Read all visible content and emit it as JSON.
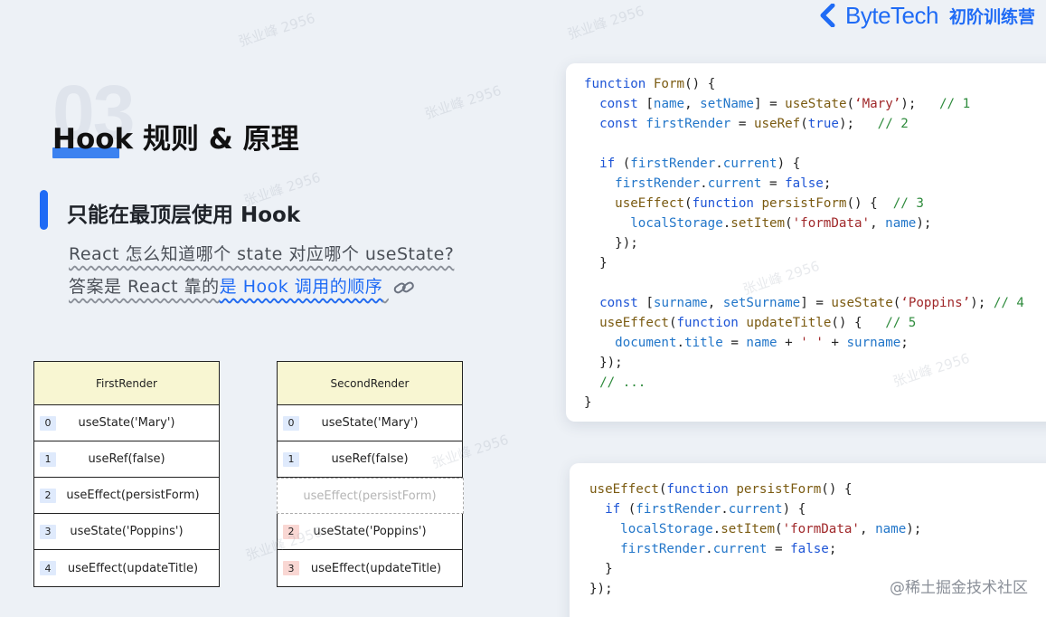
{
  "brand": {
    "name": "ByteTech",
    "subtitle": "初阶训练营",
    "color": "#1f6bf5",
    "icon": "chevron-logo-icon"
  },
  "section": {
    "number": "03",
    "title_hook": "Hook",
    "title_rest": " 规则 & 原理",
    "subheading": "只能在最顶层使用 Hook",
    "note_line1": "React 怎么知道哪个 state 对应哪个 useState?",
    "note_line2_a": "答案是 React 靠的",
    "note_line2_b": "是 Hook 调用的顺序",
    "link_icon": "link-icon"
  },
  "tables": {
    "first": {
      "header": "FirstRender",
      "rows": [
        {
          "idx": "0",
          "text": "useState('Mary')"
        },
        {
          "idx": "1",
          "text": "useRef(false)"
        },
        {
          "idx": "2",
          "text": "useEffect(persistForm)"
        },
        {
          "idx": "3",
          "text": "useState('Poppins')"
        },
        {
          "idx": "4",
          "text": "useEffect(updateTitle)"
        }
      ]
    },
    "second": {
      "header": "SecondRender",
      "rows": [
        {
          "idx": "0",
          "text": "useState('Mary')"
        },
        {
          "idx": "1",
          "text": "useRef(false)"
        },
        {
          "idx": "",
          "text": "useEffect(persistForm)"
        },
        {
          "idx": "2",
          "text": "useState('Poppins')"
        },
        {
          "idx": "3",
          "text": "useEffect(updateTitle)"
        }
      ]
    }
  },
  "code_main": [
    "function Form() {",
    "  const [name, setName] = useState(‘Mary’);   // 1",
    "  const firstRender = useRef(true);   // 2",
    "",
    "  if (firstRender.current) {",
    "    firstRender.current = false;",
    "    useEffect(function persistForm() {  // 3",
    "      localStorage.setItem('formData', name);",
    "    });",
    "  }",
    "",
    "  const [surname, setSurname] = useState(‘Poppins’); // 4",
    "  useEffect(function updateTitle() {   // 5",
    "    document.title = name + ' ' + surname;",
    "  });",
    "  // ...",
    "}"
  ],
  "code_second": [
    "useEffect(function persistForm() {",
    "  if (firstRender.current) {",
    "    localStorage.setItem('formData', name);",
    "    firstRender.current = false;",
    "  }",
    "});"
  ],
  "watermark": "张业峰 2956",
  "credit": "@稀土掘金技术社区"
}
